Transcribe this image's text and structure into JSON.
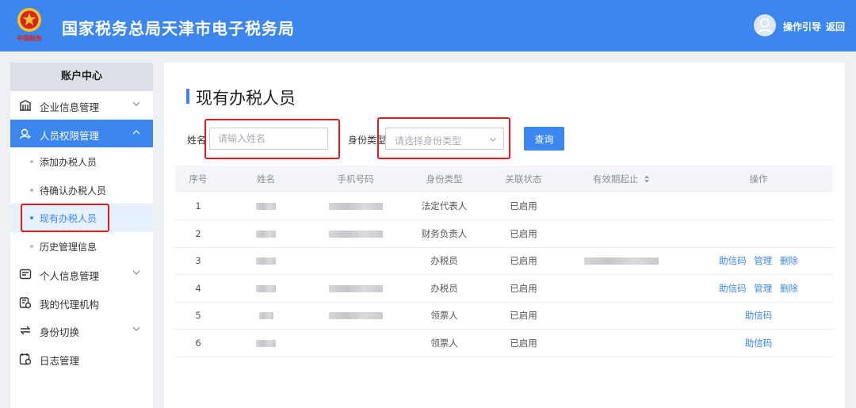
{
  "header": {
    "title": "国家税务总局天津市电子税务局",
    "logo_text": "中国税务",
    "guide_label": "操作引导",
    "back_label": "返回"
  },
  "sidebar": {
    "heading": "账户中心",
    "items": [
      {
        "label": "企业信息管理",
        "icon": "building-icon",
        "expandable": true
      },
      {
        "label": "人员权限管理",
        "icon": "user-shield-icon",
        "expandable": true,
        "active": true,
        "children": [
          {
            "label": "添加办税人员"
          },
          {
            "label": "待确认办税人员"
          },
          {
            "label": "现有办税人员",
            "current": true
          },
          {
            "label": "历史管理信息"
          }
        ]
      },
      {
        "label": "个人信息管理",
        "icon": "id-card-icon",
        "expandable": true
      },
      {
        "label": "我的代理机构",
        "icon": "agency-icon",
        "expandable": false
      },
      {
        "label": "身份切换",
        "icon": "switch-icon",
        "expandable": true
      },
      {
        "label": "日志管理",
        "icon": "log-icon",
        "expandable": false
      }
    ]
  },
  "main": {
    "title": "现有办税人员",
    "filters": {
      "name_label": "姓名",
      "name_placeholder": "请输入姓名",
      "type_label": "身份类型",
      "type_placeholder": "请选择身份类型",
      "query_label": "查询"
    },
    "table": {
      "columns": [
        "序号",
        "姓名",
        "手机号码",
        "身份类型",
        "关联状态",
        "有效期起止",
        "操作"
      ],
      "rows": [
        {
          "no": "1",
          "type": "法定代表人",
          "status": "已启用",
          "ops": []
        },
        {
          "no": "2",
          "type": "财务负责人",
          "status": "已启用",
          "ops": []
        },
        {
          "no": "3",
          "type": "办税员",
          "status": "已启用",
          "ops": [
            "助信码",
            "管理",
            "删除"
          ]
        },
        {
          "no": "4",
          "type": "办税员",
          "status": "已启用",
          "ops": [
            "助信码",
            "管理",
            "删除"
          ]
        },
        {
          "no": "5",
          "type": "领票人",
          "status": "已启用",
          "ops": [
            "助信码"
          ]
        },
        {
          "no": "6",
          "type": "领票人",
          "status": "已启用",
          "ops": [
            "助信码"
          ]
        }
      ]
    }
  },
  "colors": {
    "primary": "#3c86ef",
    "highlight": "#e3191c",
    "sidebar_head": "#dcdfe5"
  }
}
